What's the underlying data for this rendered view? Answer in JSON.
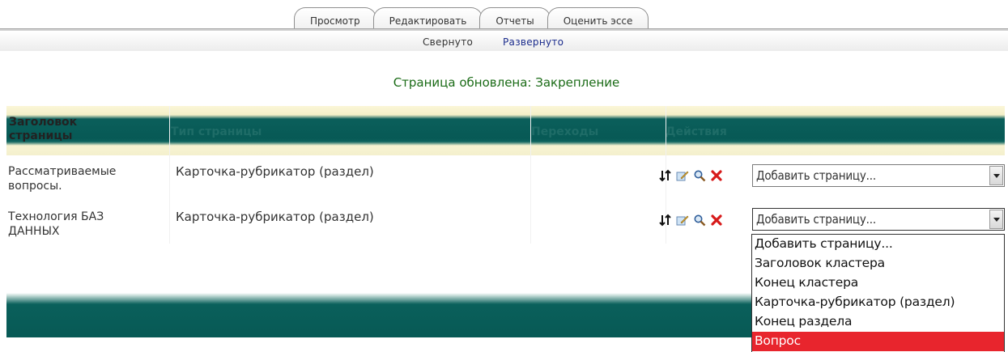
{
  "tabs": [
    {
      "label": "Просмотр"
    },
    {
      "label": "Редактировать"
    },
    {
      "label": "Отчеты"
    },
    {
      "label": "Оценить эссе"
    }
  ],
  "subtabs": [
    {
      "label": "Свернуто"
    },
    {
      "label": "Развернуто",
      "active": true
    }
  ],
  "notice": "Страница обновлена: Закрепление",
  "table": {
    "headers": {
      "title_line1": "Заголовок",
      "title_line2": "страницы",
      "type": "Тип страницы",
      "jumps": "Переходы",
      "actions": "Действия"
    },
    "rows": [
      {
        "title_line1": "Рассматриваемые",
        "title_line2": "вопросы.",
        "type": "Карточка-рубрикатор (раздел)",
        "select_value": "Добавить страницу..."
      },
      {
        "title_line1": "Технология БАЗ",
        "title_line2": "ДАННЫХ",
        "type": "Карточка-рубрикатор (раздел)",
        "select_value": "Добавить страницу..."
      }
    ],
    "action_icons": [
      "move-icon",
      "edit-icon",
      "preview-icon",
      "delete-icon"
    ]
  },
  "dropdown": {
    "options": [
      "Добавить страницу...",
      "Заголовок кластера",
      "Конец кластера",
      "Карточка-рубрикатор (раздел)",
      "Конец раздела",
      "Вопрос"
    ],
    "highlighted": "Вопрос"
  },
  "colors": {
    "header_teal": "#075955",
    "notice_green": "#1a6b16",
    "highlight_red": "#e8252d",
    "link_blue": "#1a2b8c"
  }
}
